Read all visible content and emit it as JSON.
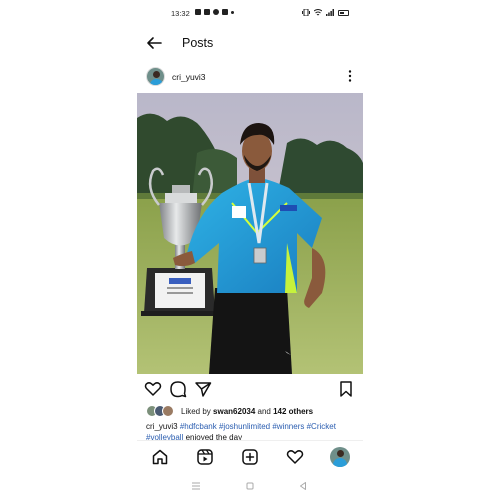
{
  "status_bar": {
    "time": "13:32"
  },
  "header": {
    "title": "Posts"
  },
  "post": {
    "username": "cri_yuvi3",
    "likes": {
      "prefix": "Liked by ",
      "liked_by": "swan62034",
      "middle": " and ",
      "others": "142 others"
    },
    "caption": {
      "username": "cri_yuvi3",
      "tags": [
        "#hdfcbank",
        "#joshunlimited",
        "#winners",
        "#Cricket",
        "#volleyball"
      ],
      "trailing": " enjoyed the day"
    }
  },
  "icons": {
    "back": "arrow-left-icon",
    "more": "more-vertical-icon",
    "like": "heart-icon",
    "comment": "comment-icon",
    "share": "send-icon",
    "save": "bookmark-icon",
    "home": "home-icon",
    "reels": "reels-icon",
    "create": "plus-square-icon",
    "activity": "heart-icon",
    "profile": "profile-avatar"
  },
  "colors": {
    "hashtag": "#2a5db0",
    "jersey": "#2b9dd8"
  }
}
